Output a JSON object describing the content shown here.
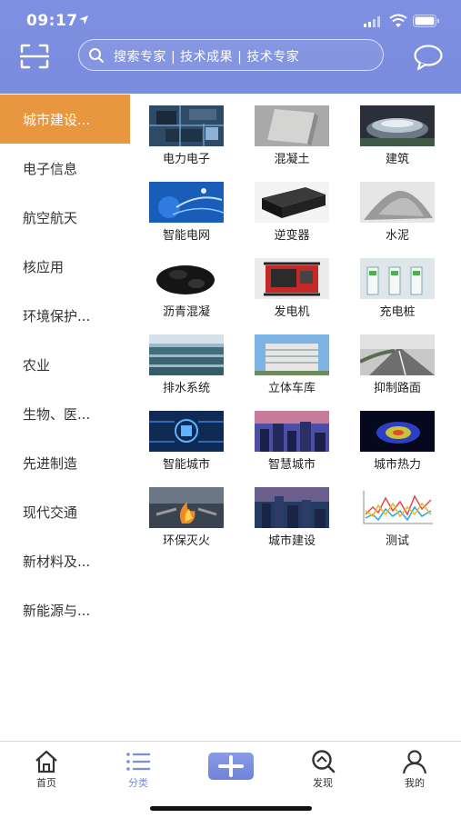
{
  "status_bar": {
    "time": "09:17"
  },
  "search": {
    "placeholder": "搜索专家 | 技术成果 | 技术专家"
  },
  "colors": {
    "header": "#7a8cde",
    "active_category": "#e8963f",
    "active_tab": "#7a8cde"
  },
  "categories": [
    {
      "label": "城市建设...",
      "active": true
    },
    {
      "label": "电子信息"
    },
    {
      "label": "航空航天"
    },
    {
      "label": "核应用"
    },
    {
      "label": "环境保护..."
    },
    {
      "label": "农业"
    },
    {
      "label": "生物、医..."
    },
    {
      "label": "先进制造"
    },
    {
      "label": "现代交通"
    },
    {
      "label": "新材料及..."
    },
    {
      "label": "新能源与..."
    }
  ],
  "items": [
    {
      "label": "电力电子",
      "image": "circuit-board"
    },
    {
      "label": "混凝土",
      "image": "concrete-slab"
    },
    {
      "label": "建筑",
      "image": "stadium"
    },
    {
      "label": "智能电网",
      "image": "globe-network"
    },
    {
      "label": "逆变器",
      "image": "inverter-box"
    },
    {
      "label": "水泥",
      "image": "cement-powder"
    },
    {
      "label": "沥青混凝",
      "image": "asphalt-gravel"
    },
    {
      "label": "发电机",
      "image": "generator"
    },
    {
      "label": "充电桩",
      "image": "charging-piles"
    },
    {
      "label": "排水系统",
      "image": "drainage-pools"
    },
    {
      "label": "立体车库",
      "image": "parking-building"
    },
    {
      "label": "抑制路面",
      "image": "road"
    },
    {
      "label": "智能城市",
      "image": "ai-chip"
    },
    {
      "label": "智慧城市",
      "image": "city-night"
    },
    {
      "label": "城市热力",
      "image": "heat-map"
    },
    {
      "label": "环保灭火",
      "image": "fire-extinguishing"
    },
    {
      "label": "城市建设",
      "image": "city-skyline"
    },
    {
      "label": "测试",
      "image": "line-chart"
    }
  ],
  "tabs": [
    {
      "label": "首页",
      "icon": "home-icon"
    },
    {
      "label": "分类",
      "icon": "list-icon",
      "active": true
    },
    {
      "label": "",
      "icon": "plus-icon"
    },
    {
      "label": "发现",
      "icon": "discover-icon"
    },
    {
      "label": "我的",
      "icon": "user-icon"
    }
  ]
}
